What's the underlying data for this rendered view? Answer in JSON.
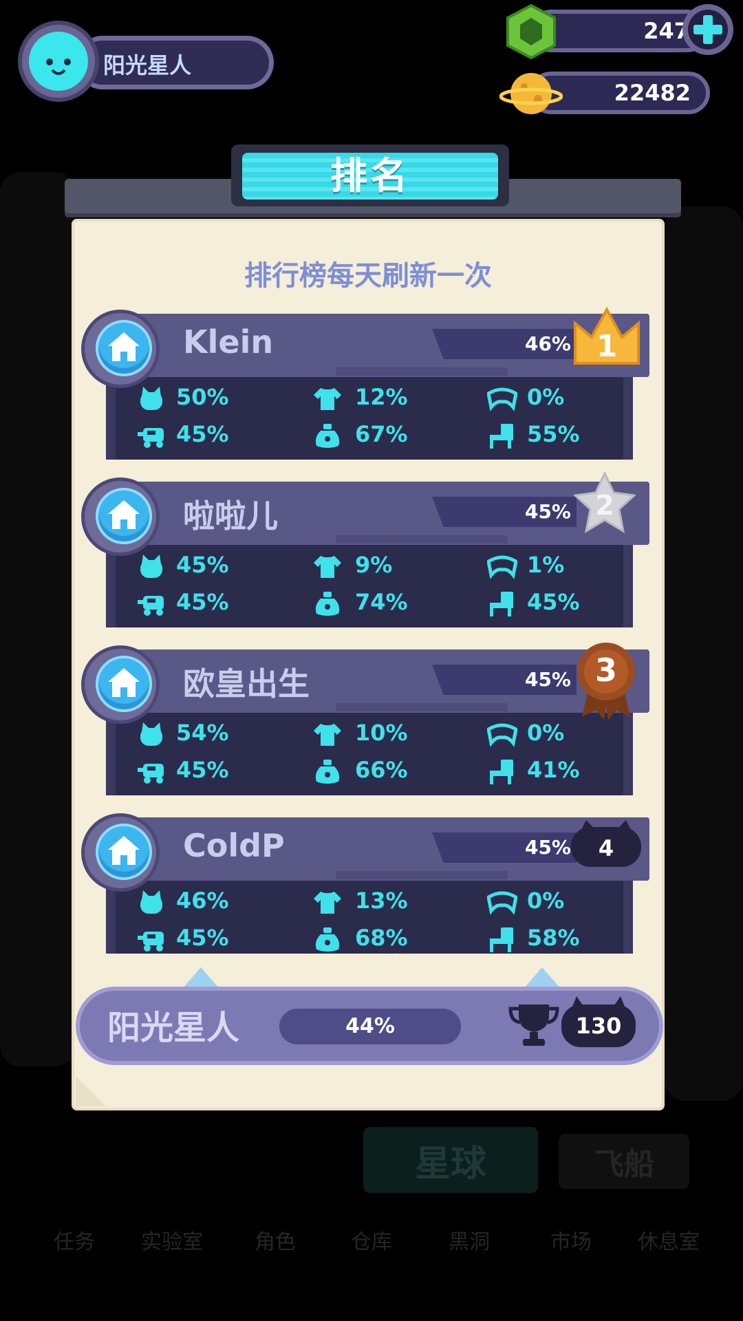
{
  "player": {
    "name": "阳光星人"
  },
  "currencies": [
    {
      "value": "247",
      "icon": "green-gem-icon",
      "has_add": true
    },
    {
      "value": "22482",
      "icon": "cheese-planet-icon",
      "has_add": false
    }
  ],
  "panel": {
    "title": "排名",
    "subtitle": "排行榜每天刷新一次"
  },
  "stat_icons": [
    "cat-icon",
    "shirt-icon",
    "mask-icon",
    "vehicle-icon",
    "sack-icon",
    "chair-icon"
  ],
  "rankings": [
    {
      "rank": "1",
      "name": "Klein",
      "percent": "46%",
      "stats": [
        "50%",
        "12%",
        "0%",
        "45%",
        "67%",
        "55%"
      ]
    },
    {
      "rank": "2",
      "name": "啦啦儿",
      "percent": "45%",
      "stats": [
        "45%",
        "9%",
        "1%",
        "45%",
        "74%",
        "45%"
      ]
    },
    {
      "rank": "3",
      "name": "欧皇出生",
      "percent": "45%",
      "stats": [
        "54%",
        "10%",
        "0%",
        "45%",
        "66%",
        "41%"
      ]
    },
    {
      "rank": "4",
      "name": "ColdP",
      "percent": "45%",
      "stats": [
        "46%",
        "13%",
        "0%",
        "45%",
        "68%",
        "58%"
      ]
    }
  ],
  "self": {
    "name": "阳光星人",
    "percent": "44%",
    "rank": "130"
  },
  "background": {
    "tabs": [
      "星球",
      "飞船"
    ],
    "nav": [
      "任务",
      "实验室",
      "角色",
      "仓库",
      "黑洞",
      "市场",
      "休息室"
    ]
  }
}
